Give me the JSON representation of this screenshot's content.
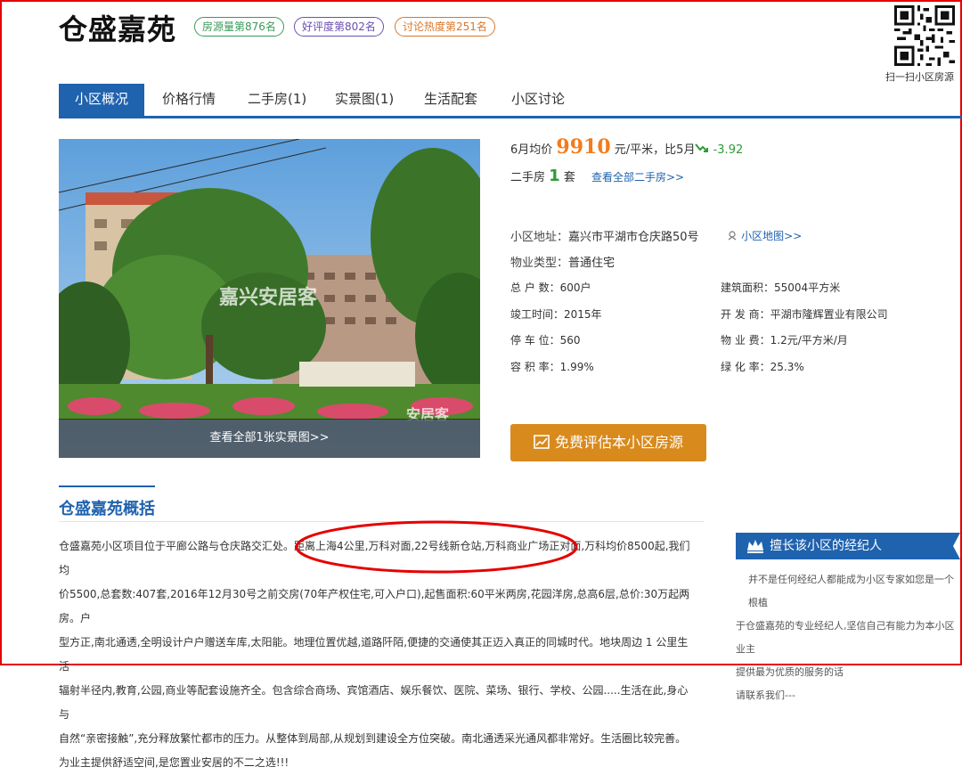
{
  "header": {
    "title": "仓盛嘉苑",
    "badges": [
      "房源量第876名",
      "好评度第802名",
      "讨论热度第251名"
    ],
    "qr_caption": "扫一扫小区房源"
  },
  "tabs": [
    "小区概况",
    "价格行情",
    "二手房(1)",
    "实景图(1)",
    "生活配套",
    "小区讨论"
  ],
  "photo": {
    "view_all": "查看全部1张实景图>>",
    "watermark_top": "嘉兴安居客",
    "watermark_bottom": "安居客"
  },
  "price": {
    "label": "6月均价",
    "value": "9910",
    "unit": "元/平米，比5月",
    "change": "-3.92"
  },
  "second_hand": {
    "label": "二手房",
    "count": "1",
    "unit": "套",
    "link": "查看全部二手房>>"
  },
  "address": {
    "label": "小区地址：",
    "value": "嘉兴市平湖市仓庆路50号",
    "map_link": "小区地图>>"
  },
  "property_type": {
    "label": "物业类型：",
    "value": "普通住宅"
  },
  "details": [
    {
      "label": "总 户 数：",
      "value": "600户"
    },
    {
      "label": "建筑面积：",
      "value": "55004平方米"
    },
    {
      "label": "竣工时间：",
      "value": "2015年"
    },
    {
      "label": "开 发 商：",
      "value": "平湖市隆辉置业有限公司"
    },
    {
      "label": "停 车 位：",
      "value": "560"
    },
    {
      "label": "物 业 费：",
      "value": "1.2元/平方米/月"
    },
    {
      "label": "容 积 率：",
      "value": "1.99%"
    },
    {
      "label": "绿 化 率：",
      "value": "25.3%"
    }
  ],
  "eval_button": "免费评估本小区房源",
  "summary": {
    "title": "仓盛嘉苑概括",
    "lines": [
      "仓盛嘉苑小区项目位于平廊公路与仓庆路交汇处。距离上海4公里,万科对面,22号线新仓站,万科商业广场正对面,万科均价8500起,我们均",
      "价5500,总套数:407套,2016年12月30号之前交房(70年产权住宅,可入户口),起售面积:60平米两房,花园洋房,总高6层,总价:30万起两房。户",
      "型方正,南北通透,全明设计户户赠送车库,太阳能。地理位置优越,道路阡陌,便捷的交通使其正迈入真正的同城时代。地块周边 1 公里生活",
      "辐射半径内,教育,公园,商业等配套设施齐全。包含综合商场、宾馆酒店、娱乐餐饮、医院、菜场、银行、学校、公园.....生活在此,身心与",
      "自然“亲密接触”,充分释放繁忙都市的压力。从整体到局部,从规划到建设全方位突破。南北通透采光通风都非常好。生活圈比较完善。",
      "为业主提供舒适空间,是您置业安居的不二之选!!!"
    ]
  },
  "agent": {
    "title": "擅长该小区的经纪人",
    "lines": [
      "并不是任何经纪人都能成为小区专家如您是一个根植",
      "于仓盛嘉苑的专业经纪人,坚信自己有能力为本小区业主",
      "提供最为优质的服务的话",
      "请联系我们---"
    ]
  },
  "colors": {
    "brand_blue": "#1f62ae",
    "price_orange": "#f57b1a",
    "trend_green": "#2e9a3a",
    "button_orange": "#d98a1d",
    "annotation_red": "#e60000"
  }
}
